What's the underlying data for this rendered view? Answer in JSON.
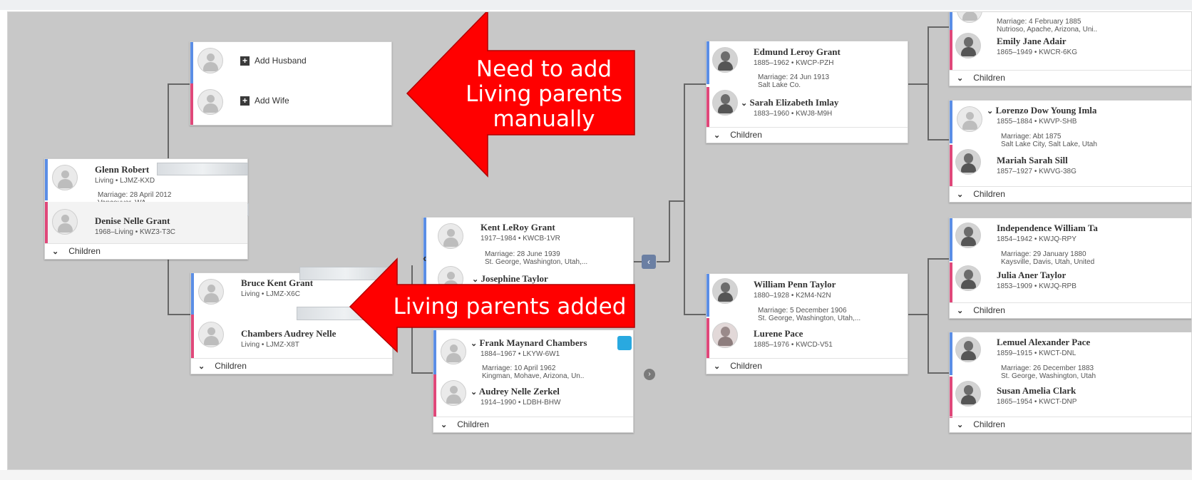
{
  "annotations": {
    "top_arrow_text": "Need to add Living parents manually",
    "bottom_arrow_text": "Living parents added",
    "arrow_color": "#ff0000"
  },
  "colors": {
    "male_bar": "#5b8ee6",
    "female_bar": "#e0487a",
    "canvas_bg": "#c8c8c8"
  },
  "common": {
    "children_label": "Children",
    "chevron": "⌄",
    "add_glyph": "+"
  },
  "unknown_parents": {
    "add_husband": "Add Husband",
    "add_wife": "Add Wife"
  },
  "root": {
    "husband": {
      "name": "Glenn Robert",
      "info": "Living • LJMZ-KXD"
    },
    "marriage": "Marriage: 28 April 2012",
    "place": "Vancouver, WA",
    "wife": {
      "name": "Denise Nelle Grant",
      "info": "1968–Living • KWZ3-T3C"
    }
  },
  "parents": {
    "husband": {
      "name": "Bruce Kent Grant",
      "info": "Living • LJMZ-X6C"
    },
    "wife": {
      "name": "Chambers Audrey Nelle",
      "info": "Living • LJMZ-X8T"
    }
  },
  "gen2a": {
    "husband": {
      "name": "Kent LeRoy Grant",
      "info": "1917–1984 • KWCB-1VR"
    },
    "marriage": "Marriage: 28 June 1939",
    "place": "St. George, Washington, Utah,...",
    "wife": {
      "name": "Josephine Taylor"
    }
  },
  "gen2b": {
    "husband": {
      "name": "Frank Maynard Chambers",
      "info": "1884–1967 • LKYW-6W1"
    },
    "marriage": "Marriage: 10 April 1962",
    "place": "Kingman, Mohave, Arizona, Un..",
    "wife": {
      "name": "Audrey Nelle Zerkel",
      "info": "1914–1990 • LDBH-BHW"
    }
  },
  "gen3a": {
    "husband": {
      "name": "Edmund Leroy Grant",
      "info": "1885–1962 • KWCP-PZH"
    },
    "marriage": "Marriage: 24 Jun 1913",
    "place": "Salt Lake Co.",
    "wife": {
      "name": "Sarah Elizabeth Imlay",
      "info": "1883–1960 • KWJ8-M9H"
    }
  },
  "gen3b": {
    "husband": {
      "name": "William Penn Taylor",
      "info": "1880–1928 • K2M4-N2N"
    },
    "marriage": "Marriage: 5 December 1906",
    "place": "St. George, Washington, Utah,...",
    "wife": {
      "name": "Lurene Pace",
      "info": "1885–1976 • KWCD-V51"
    }
  },
  "gen4a": {
    "marriage": "Marriage: 4 February 1885",
    "place": "Nutrioso, Apache, Arizona, Uni..",
    "wife": {
      "name": "Emily Jane Adair",
      "info": "1865–1949 • KWCR-6KG"
    }
  },
  "gen4b": {
    "husband": {
      "name": "Lorenzo Dow Young Imla",
      "info": "1855–1884 • KWVP-SHB"
    },
    "marriage": "Marriage: Abt 1875",
    "place": "Salt Lake City, Salt Lake, Utah",
    "wife": {
      "name": "Mariah Sarah Sill",
      "info": "1857–1927 • KWVG-38G"
    }
  },
  "gen4c": {
    "husband": {
      "name": "Independence William Ta",
      "info": "1854–1942 • KWJQ-RPY"
    },
    "marriage": "Marriage: 29 January 1880",
    "place": "Kaysville, Davis, Utah, United",
    "wife": {
      "name": "Julia Aner Taylor",
      "info": "1853–1909 • KWJQ-RPB"
    }
  },
  "gen4d": {
    "husband": {
      "name": "Lemuel Alexander Pace",
      "info": "1859–1915 • KWCT-DNL"
    },
    "marriage": "Marriage: 26 December 1883",
    "place": "St. George, Washington, Utah",
    "wife": {
      "name": "Susan Amelia Clark",
      "info": "1865–1954 • KWCT-DNP"
    }
  }
}
